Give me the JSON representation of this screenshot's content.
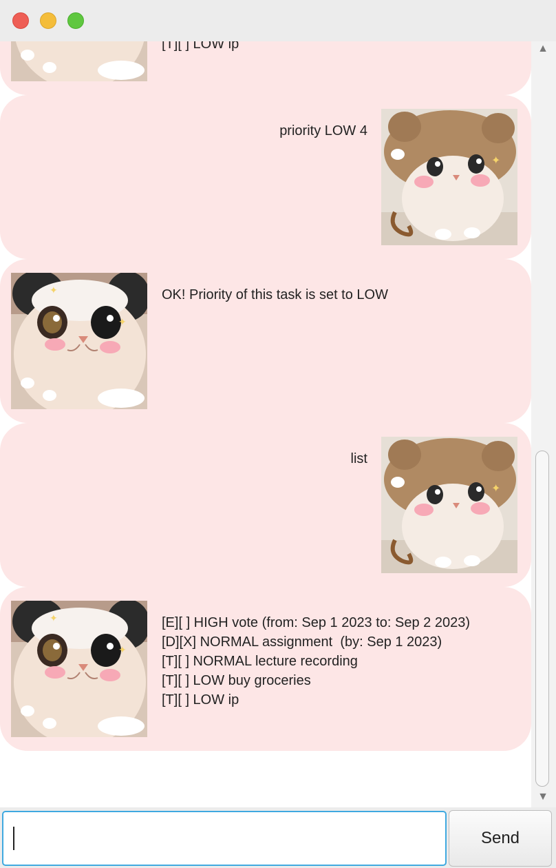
{
  "window": {
    "buttons": {
      "close": "close",
      "minimize": "minimize",
      "zoom": "zoom"
    },
    "colors": {
      "close": "#ee5e55",
      "minimize": "#f4bd3a",
      "zoom": "#5fc73f"
    }
  },
  "colors": {
    "bubble_background": "#fde6e6",
    "input_focus_border": "#3fa9e0"
  },
  "dialogs": [
    {
      "sender": "bot",
      "avatar": "cat-headband-avatar",
      "text": "[E][ ] HIGH vote (from: Sep 1 2023 to: Sep 2 2023)\n[D][X] NORMAL assignment  (by: Sep 1 2023)\n[T][ ] NORMAL lecture recording\n[T][ ] NORMAL buy groceries\n[T][ ] LOW ip"
    },
    {
      "sender": "user",
      "avatar": "cat-bear-hat-avatar",
      "text": "priority LOW 4"
    },
    {
      "sender": "bot",
      "avatar": "cat-headband-avatar",
      "text": "OK! Priority of this task is set to LOW"
    },
    {
      "sender": "user",
      "avatar": "cat-bear-hat-avatar",
      "text": "list"
    },
    {
      "sender": "bot",
      "avatar": "cat-headband-avatar",
      "text": "[E][ ] HIGH vote (from: Sep 1 2023 to: Sep 2 2023)\n[D][X] NORMAL assignment  (by: Sep 1 2023)\n[T][ ] NORMAL lecture recording\n[T][ ] LOW buy groceries\n[T][ ] LOW ip"
    }
  ],
  "input": {
    "value": "",
    "placeholder": ""
  },
  "send_button": {
    "label": "Send"
  },
  "scrollbar": {
    "up_arrow": "▲",
    "down_arrow": "▼"
  }
}
